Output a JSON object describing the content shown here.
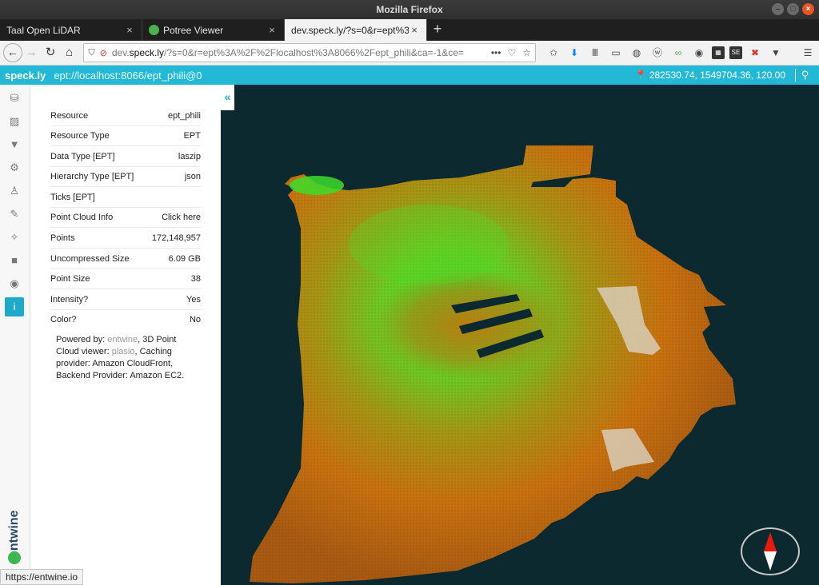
{
  "window": {
    "title": "Mozilla Firefox"
  },
  "tabs": [
    {
      "label": "Taal Open LiDAR"
    },
    {
      "label": "Potree Viewer"
    },
    {
      "label": "dev.speck.ly/?s=0&r=ept%3A"
    }
  ],
  "address": {
    "prefix": "dev.",
    "domain": "speck.ly",
    "rest": "/?s=0&r=ept%3A%2F%2Flocalhost%3A8066%2Fept_phili&ca=-1&ce="
  },
  "app": {
    "brand": "speck.ly",
    "resource_path": "ept://localhost:8066/ept_phili@0",
    "coordinates": "282530.74, 1549704.36, 120.00"
  },
  "info": {
    "rows": [
      {
        "label": "Resource",
        "value": "ept_phili"
      },
      {
        "label": "Resource Type",
        "value": "EPT"
      },
      {
        "label": "Data Type [EPT]",
        "value": "laszip"
      },
      {
        "label": "Hierarchy Type [EPT]",
        "value": "json"
      },
      {
        "label": "Ticks [EPT]",
        "value": ""
      },
      {
        "label": "Point Cloud Info",
        "value": "Click here"
      },
      {
        "label": "Points",
        "value": "172,148,957"
      },
      {
        "label": "Uncompressed Size",
        "value": "6.09 GB"
      },
      {
        "label": "Point Size",
        "value": "38"
      },
      {
        "label": "Intensity?",
        "value": "Yes"
      },
      {
        "label": "Color?",
        "value": "No"
      }
    ],
    "powered": {
      "p1": "Powered by: ",
      "entwine": "entwine",
      "p2": ", 3D Point Cloud viewer: ",
      "plasio": "plasio",
      "p3": ", Caching provider: Amazon CloudFront, Backend Provider: Amazon EC2."
    }
  },
  "sidebar": {
    "logo_text": "entwine"
  },
  "status_bar": {
    "url": "https://entwine.io"
  },
  "colors": {
    "accent": "#22b8d6",
    "viewer_bg": "#0c2930"
  }
}
